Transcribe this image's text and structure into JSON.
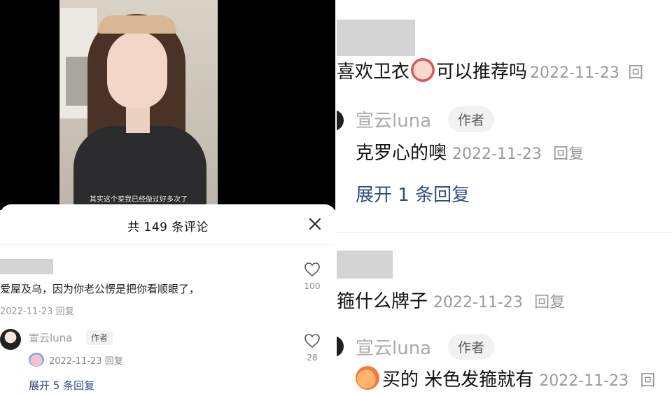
{
  "video": {
    "subtitle": "其实这个菜我已经做过好多次了"
  },
  "comments_sheet": {
    "title": "共 149 条评论",
    "comment": {
      "text": "爱屋及乌，因为你老公愣是把你看顺眼了，",
      "date": "2022-11-23",
      "reply_label": "回复",
      "likes": "100"
    },
    "author_reply": {
      "username": "宣云luna",
      "author_tag": "作者",
      "date": "2022-11-23",
      "reply_label": "回复",
      "likes": "28"
    },
    "expand_label": "展开 5 条回复"
  },
  "zoomed_panel": {
    "comment1": {
      "text_before": "喜欢卫衣",
      "text_after": "可以推荐吗",
      "date": "2022-11-23",
      "reply_label": "回"
    },
    "reply1": {
      "username": "宣云luna",
      "author_tag": "作者",
      "text": "克罗心的噢",
      "date": "2022-11-23",
      "reply_label": "回复"
    },
    "expand_label": "展开 1 条回复",
    "comment2": {
      "text": "箍什么牌子",
      "date": "2022-11-23",
      "reply_label": "回复"
    },
    "reply2": {
      "username": "宣云luna",
      "author_tag": "作者",
      "text": "买的 米色发箍就有",
      "date": "2022-11-23",
      "reply_label": "回"
    }
  },
  "colors": {
    "link": "#2f4f7f",
    "meta_gray": "#999999",
    "tag_bg": "#f2f2f2"
  },
  "icons": [
    "close-icon",
    "heart-icon",
    "emoji-icon",
    "peach-emoji-icon"
  ]
}
